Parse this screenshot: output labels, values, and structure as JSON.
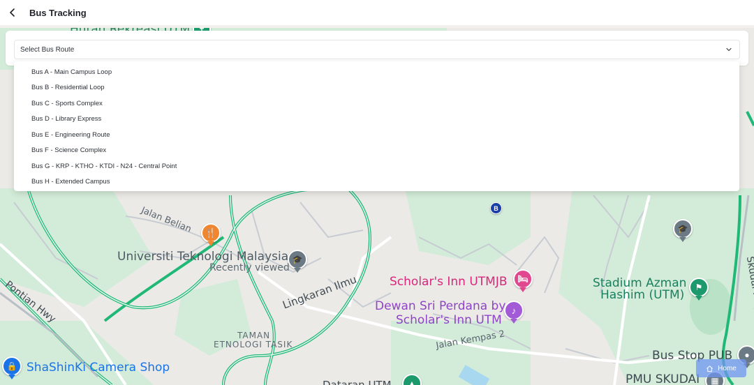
{
  "header": {
    "title": "Bus Tracking"
  },
  "route_select": {
    "placeholder": "Select Bus Route",
    "options": [
      "Bus A - Main Campus Loop",
      "Bus B - Residential Loop",
      "Bus C - Sports Complex",
      "Bus D - Library Express",
      "Bus E - Engineering Route",
      "Bus F - Science Complex",
      "Bus G - KRP - KTHO - KTDI - N24 - Central Point",
      "Bus H - Extended Campus"
    ]
  },
  "map": {
    "labels": {
      "hutan": "Hutan Rekreasi UTM",
      "utm": "Universiti Teknologi Malaysia",
      "recently_viewed": "Recently viewed",
      "scholars_inn": "Scholar's Inn UTMJB",
      "dewan_1": "Dewan Sri Perdana by",
      "dewan_2": "Scholar's Inn UTM",
      "stadium_1": "Stadium Azman",
      "stadium_2": "Hashim (UTM)",
      "taman_1": "TAMAN",
      "taman_2": "ETNOLOGI TASIK",
      "shashinki": "ShaShinKi Camera Shop",
      "bus_stop": "Bus Stop PUB",
      "pmu": "PMU SKUDAI",
      "dataran": "Dataran UTM",
      "jalan_belian": "Jalan Belian",
      "lingkaran": "Lingkaran Ilmu",
      "jalan_kempas": "Jalan Kempas 2",
      "pontian": "Pontian Hwy",
      "skudai_hwy": "Skudai Hwy"
    },
    "bus_marker": "B",
    "colors": {
      "green_area": "#d3ecd9",
      "road_green": "#1fb877",
      "bus_marker": "#1a3fa6"
    }
  },
  "home": {
    "label": "Home"
  }
}
